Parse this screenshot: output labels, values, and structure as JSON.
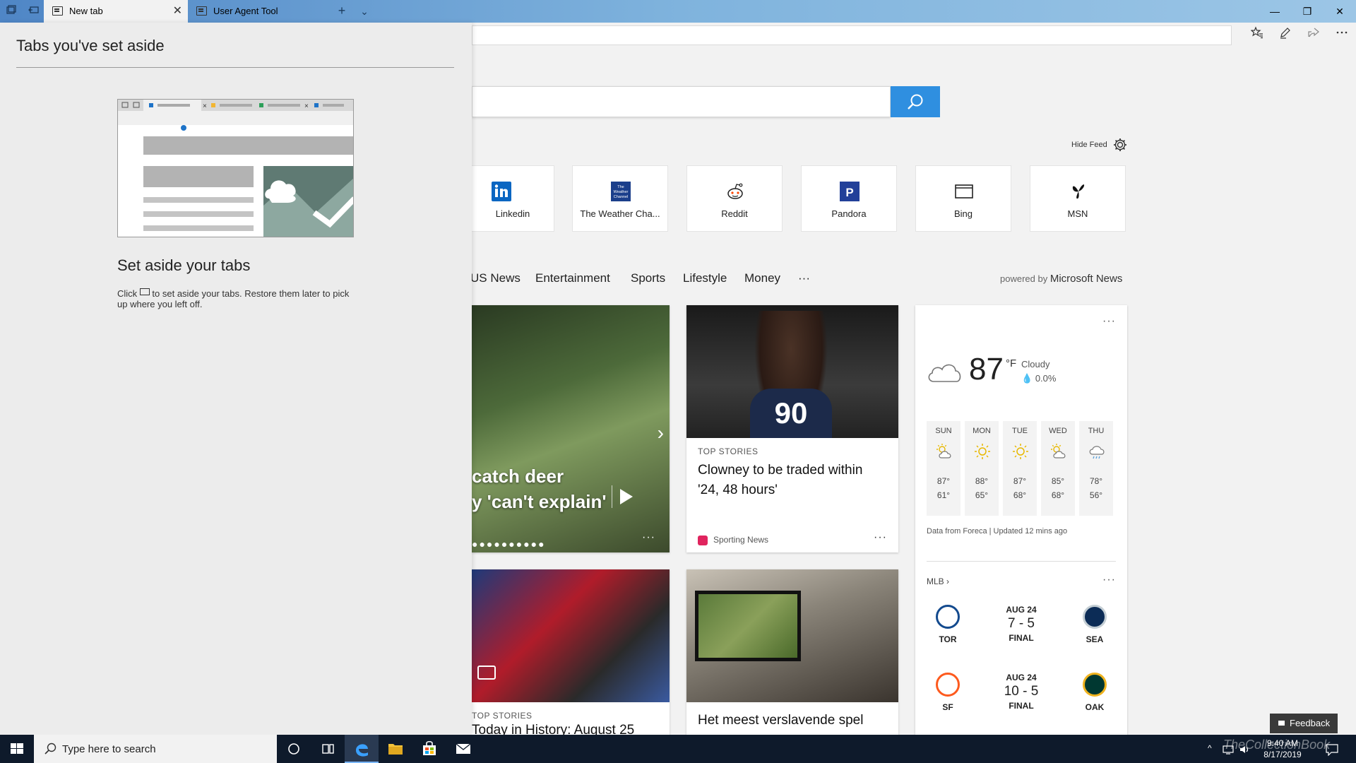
{
  "browser": {
    "tabs": [
      {
        "title": "New tab",
        "active": true
      },
      {
        "title": "User Agent Tool",
        "active": false
      }
    ],
    "new_tab_symbol": "+",
    "tab_list_symbol": "⌄",
    "close_symbol": "✕",
    "window_controls": {
      "minimize": "—",
      "restore": "❐",
      "close": "✕"
    },
    "toolbar_icons": [
      "favorites-icon",
      "pen-icon",
      "share-icon",
      "more-icon"
    ]
  },
  "set_aside_panel": {
    "title": "Tabs you've set aside",
    "heading": "Set aside your tabs",
    "text_before": "Click",
    "text_after": "to set aside your tabs. Restore them later to pick up where you left off."
  },
  "new_tab_page": {
    "hide_feed_label": "Hide Feed",
    "top_sites": [
      {
        "label": "Linkedin",
        "icon": "linkedin-icon",
        "color": "#0a66c2"
      },
      {
        "label": "The Weather Cha...",
        "icon": "weather-channel-icon",
        "color": "#1b3f8b"
      },
      {
        "label": "Reddit",
        "icon": "reddit-icon",
        "color": "#ff4500"
      },
      {
        "label": "Pandora",
        "icon": "pandora-icon",
        "color": "#224099"
      },
      {
        "label": "Bing",
        "icon": "bing-icon",
        "color": "#222222"
      },
      {
        "label": "MSN",
        "icon": "msn-icon",
        "color": "#111111"
      }
    ],
    "nav_items": [
      "US News",
      "Entertainment",
      "Sports",
      "Lifestyle",
      "Money",
      "···"
    ],
    "powered_by_prefix": "powered by",
    "powered_by_brand": "Microsoft News",
    "hero": {
      "line1": "catch deer",
      "line2": "y 'can't explain'",
      "more": "···"
    },
    "story_clowney": {
      "category": "TOP STORIES",
      "headline": "Clowney to be traded within '24, 48 hours'",
      "source": "Sporting News",
      "jersey": "90",
      "more": "···"
    },
    "story_history": {
      "category": "TOP STORIES",
      "headline": "Today in History: August 25"
    },
    "story_game": {
      "headline": "Het meest verslavende spel"
    },
    "weather": {
      "temperature": "87",
      "unit": "°F",
      "condition": "Cloudy",
      "precipitation": "0.0%",
      "forecast": [
        {
          "day": "SUN",
          "high": "87°",
          "low": "61°",
          "icon": "partly-sunny-icon"
        },
        {
          "day": "MON",
          "high": "88°",
          "low": "65°",
          "icon": "sunny-icon"
        },
        {
          "day": "TUE",
          "high": "87°",
          "low": "68°",
          "icon": "sunny-icon"
        },
        {
          "day": "WED",
          "high": "85°",
          "low": "68°",
          "icon": "partly-sunny-icon"
        },
        {
          "day": "THU",
          "high": "78°",
          "low": "56°",
          "icon": "rain-icon"
        }
      ],
      "data_source": "Data from Foreca | Updated 12 mins ago",
      "more": "···"
    },
    "mlb": {
      "label": "MLB",
      "more": "···",
      "games": [
        {
          "home": "TOR",
          "away": "SEA",
          "date": "AUG 24",
          "score": "7 - 5",
          "status": "FINAL",
          "home_color": "#134a8e",
          "away_color": "#0c2c56"
        },
        {
          "home": "SF",
          "away": "OAK",
          "date": "AUG 24",
          "score": "10 - 5",
          "status": "FINAL",
          "home_color": "#fd5a1e",
          "away_color": "#003831"
        }
      ]
    },
    "feedback_label": "Feedback"
  },
  "taskbar": {
    "search_placeholder": "Type here to search",
    "time": "9:40 AM",
    "date": "8/17/2019",
    "watermark": "TheCollectionBook"
  },
  "colors": {
    "accent": "#2f8fe0",
    "taskbar": "#0e1a2b"
  }
}
